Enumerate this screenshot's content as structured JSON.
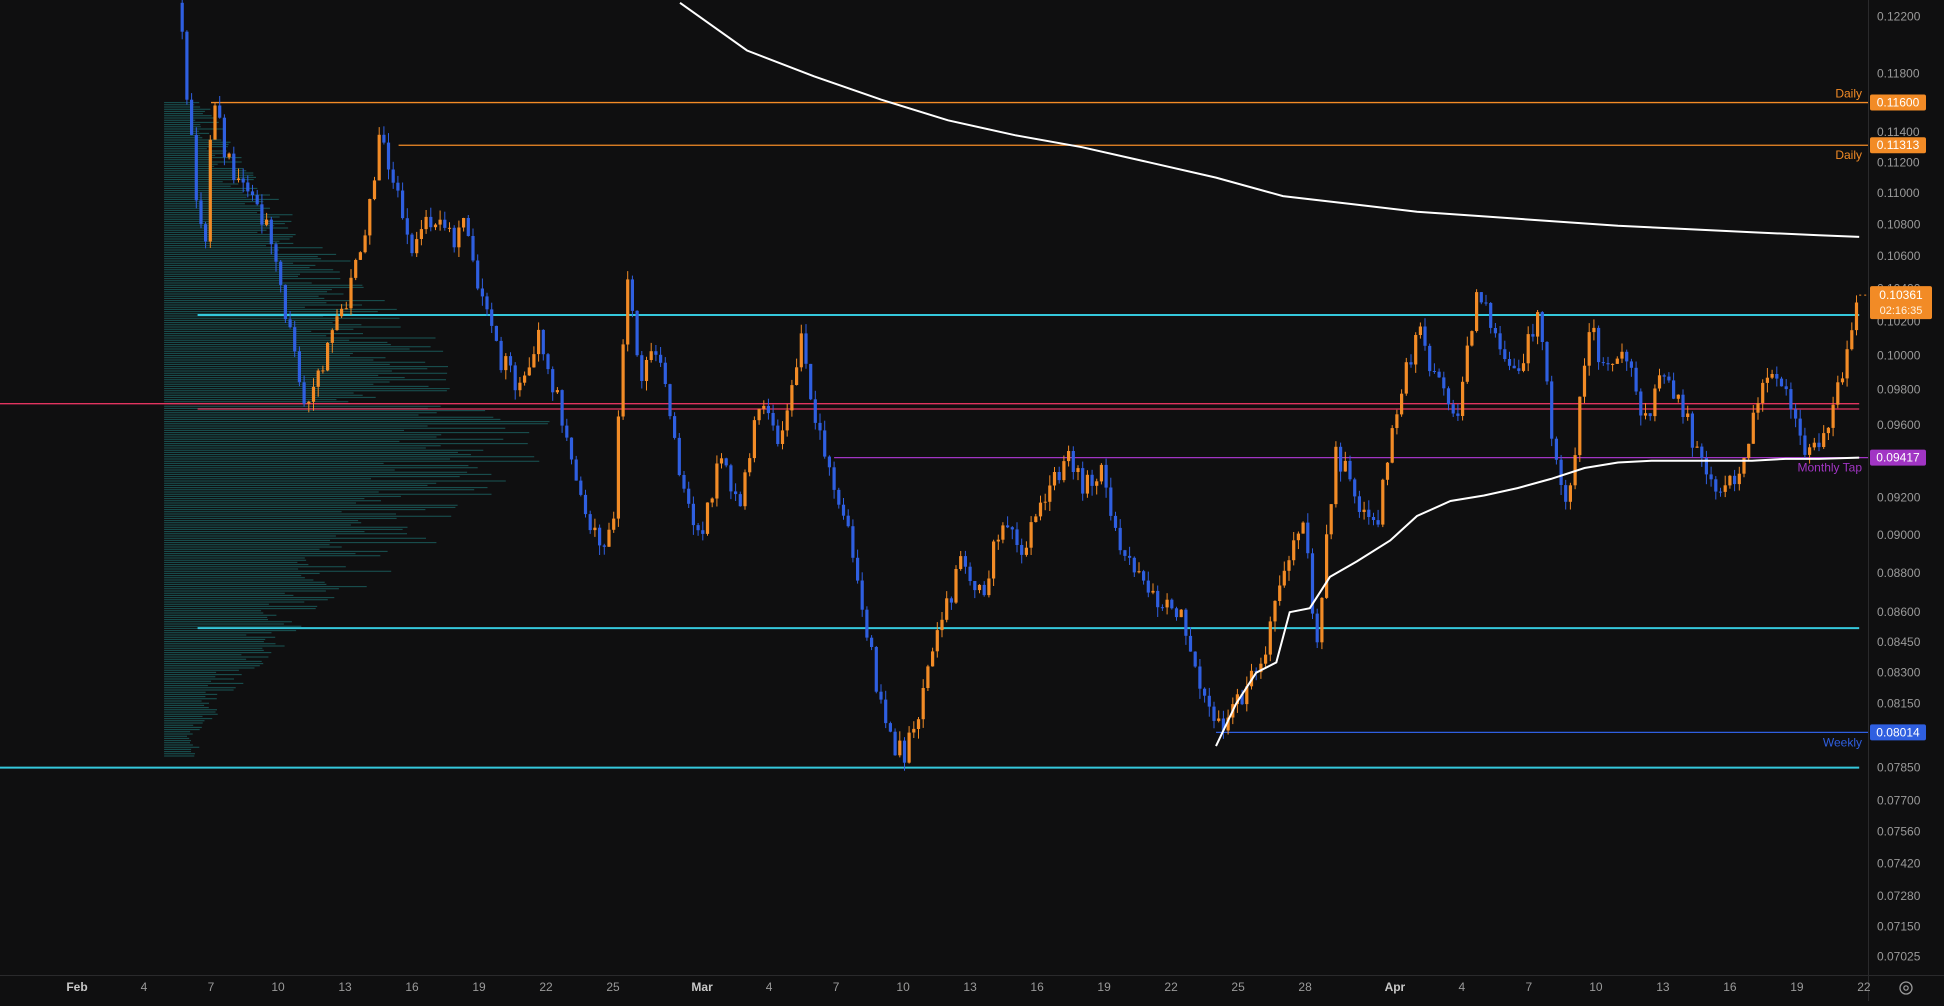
{
  "chart_data": {
    "type": "candlestick",
    "title": "",
    "xlabel": "",
    "ylabel": "",
    "x_range": [
      -2,
      29
    ],
    "y_scale": "log",
    "ylim": [
      0.0695,
      0.1232
    ],
    "grid": false,
    "colors": {
      "background": "#0f0f10",
      "up": "#f28b26",
      "down": "#2f5fe0",
      "cyan_level": "#35c8dc",
      "red_level": "#e2345f",
      "purple_level": "#a135c4",
      "daily_level": "#f28b26",
      "weekly_level": "#2f5fe0",
      "ma_line": "#ffffff",
      "volume_profile": "#1f7b7b",
      "axis_text": "#9a9a9a"
    },
    "y_ticks": [
      "0.12200",
      "0.11800",
      "0.11400",
      "0.11200",
      "0.11000",
      "0.10800",
      "0.10600",
      "0.10400",
      "0.10200",
      "0.10000",
      "0.09800",
      "0.09600",
      "0.09200",
      "0.09000",
      "0.08800",
      "0.08600",
      "0.08450",
      "0.08300",
      "0.08150",
      "0.07850",
      "0.07700",
      "0.07560",
      "0.07420",
      "0.07280",
      "0.07150",
      "0.07025"
    ],
    "x_ticks": [
      {
        "label": "Feb",
        "x": 0
      },
      {
        "label": "4",
        "x": 1
      },
      {
        "label": "7",
        "x": 2
      },
      {
        "label": "10",
        "x": 3
      },
      {
        "label": "13",
        "x": 4
      },
      {
        "label": "16",
        "x": 5
      },
      {
        "label": "19",
        "x": 6
      },
      {
        "label": "22",
        "x": 7
      },
      {
        "label": "25",
        "x": 8
      },
      {
        "label": "Mar",
        "x": 9.33
      },
      {
        "label": "4",
        "x": 10.33
      },
      {
        "label": "7",
        "x": 11.33
      },
      {
        "label": "10",
        "x": 12.33
      },
      {
        "label": "13",
        "x": 13.33
      },
      {
        "label": "16",
        "x": 14.33
      },
      {
        "label": "19",
        "x": 15.33
      },
      {
        "label": "22",
        "x": 16.33
      },
      {
        "label": "25",
        "x": 17.33
      },
      {
        "label": "28",
        "x": 18.33
      },
      {
        "label": "Apr",
        "x": 19.67
      },
      {
        "label": "4",
        "x": 20.67
      },
      {
        "label": "7",
        "x": 21.67
      },
      {
        "label": "10",
        "x": 22.67
      },
      {
        "label": "13",
        "x": 23.67
      },
      {
        "label": "16",
        "x": 24.67
      },
      {
        "label": "19",
        "x": 25.67
      },
      {
        "label": "22",
        "x": 26.67
      }
    ],
    "price_path": [
      [
        1.5,
        0.123
      ],
      [
        1.6,
        0.119
      ],
      [
        1.75,
        0.111
      ],
      [
        1.9,
        0.106
      ],
      [
        2.0,
        0.114
      ],
      [
        2.05,
        0.1165
      ],
      [
        2.2,
        0.1125
      ],
      [
        2.4,
        0.111
      ],
      [
        2.6,
        0.1095
      ],
      [
        2.8,
        0.108
      ],
      [
        3.0,
        0.105
      ],
      [
        3.2,
        0.101
      ],
      [
        3.4,
        0.0975
      ],
      [
        3.6,
        0.0985
      ],
      [
        3.8,
        0.1015
      ],
      [
        4.0,
        0.103
      ],
      [
        4.3,
        0.108
      ],
      [
        4.55,
        0.114
      ],
      [
        4.7,
        0.111
      ],
      [
        5.0,
        0.1065
      ],
      [
        5.3,
        0.1085
      ],
      [
        5.6,
        0.107
      ],
      [
        5.8,
        0.109
      ],
      [
        6.0,
        0.104
      ],
      [
        6.3,
        0.1
      ],
      [
        6.6,
        0.098
      ],
      [
        6.9,
        0.101
      ],
      [
        7.2,
        0.097
      ],
      [
        7.5,
        0.092
      ],
      [
        7.8,
        0.0895
      ],
      [
        8.0,
        0.0905
      ],
      [
        8.2,
        0.1045
      ],
      [
        8.4,
        0.099
      ],
      [
        8.7,
        0.1005
      ],
      [
        9.0,
        0.0935
      ],
      [
        9.3,
        0.0895
      ],
      [
        9.6,
        0.0945
      ],
      [
        9.9,
        0.0915
      ],
      [
        10.2,
        0.098
      ],
      [
        10.5,
        0.095
      ],
      [
        10.8,
        0.101
      ],
      [
        11.0,
        0.0965
      ],
      [
        11.3,
        0.092
      ],
      [
        11.6,
        0.089
      ],
      [
        11.9,
        0.083
      ],
      [
        12.1,
        0.08
      ],
      [
        12.35,
        0.079
      ],
      [
        12.6,
        0.0815
      ],
      [
        12.9,
        0.0855
      ],
      [
        13.2,
        0.0885
      ],
      [
        13.5,
        0.087
      ],
      [
        13.8,
        0.0905
      ],
      [
        14.1,
        0.089
      ],
      [
        14.4,
        0.092
      ],
      [
        14.8,
        0.094
      ],
      [
        15.0,
        0.0925
      ],
      [
        15.3,
        0.0935
      ],
      [
        15.6,
        0.089
      ],
      [
        15.9,
        0.0875
      ],
      [
        16.2,
        0.0865
      ],
      [
        16.5,
        0.086
      ],
      [
        16.8,
        0.082
      ],
      [
        17.1,
        0.08
      ],
      [
        17.4,
        0.082
      ],
      [
        17.7,
        0.0835
      ],
      [
        18.0,
        0.0885
      ],
      [
        18.3,
        0.091
      ],
      [
        18.5,
        0.0845
      ],
      [
        18.8,
        0.0945
      ],
      [
        19.1,
        0.092
      ],
      [
        19.4,
        0.0905
      ],
      [
        19.7,
        0.097
      ],
      [
        20.0,
        0.1015
      ],
      [
        20.3,
        0.0985
      ],
      [
        20.6,
        0.0965
      ],
      [
        20.9,
        0.104
      ],
      [
        21.2,
        0.101
      ],
      [
        21.5,
        0.0985
      ],
      [
        21.8,
        0.1025
      ],
      [
        22.1,
        0.093
      ],
      [
        22.3,
        0.092
      ],
      [
        22.55,
        0.102
      ],
      [
        22.8,
        0.099
      ],
      [
        23.1,
        0.1
      ],
      [
        23.4,
        0.096
      ],
      [
        23.7,
        0.099
      ],
      [
        24.0,
        0.0965
      ],
      [
        24.3,
        0.093
      ],
      [
        24.6,
        0.0925
      ],
      [
        24.9,
        0.094
      ],
      [
        25.2,
        0.0995
      ],
      [
        25.5,
        0.0975
      ],
      [
        25.8,
        0.094
      ],
      [
        26.1,
        0.096
      ],
      [
        26.4,
        0.0995
      ],
      [
        26.6,
        0.1036
      ]
    ],
    "ma_line": [
      [
        9.0,
        0.123
      ],
      [
        10.0,
        0.1196
      ],
      [
        11.0,
        0.1178
      ],
      [
        12.0,
        0.1162
      ],
      [
        13.0,
        0.1148
      ],
      [
        14.0,
        0.1138
      ],
      [
        15.0,
        0.113
      ],
      [
        16.0,
        0.112
      ],
      [
        17.0,
        0.111
      ],
      [
        18.0,
        0.1098
      ],
      [
        19.0,
        0.1093
      ],
      [
        20.0,
        0.1088
      ],
      [
        21.0,
        0.1085
      ],
      [
        22.0,
        0.1082
      ],
      [
        23.0,
        0.1079
      ],
      [
        24.0,
        0.1077
      ],
      [
        25.0,
        0.1075
      ],
      [
        26.0,
        0.1073
      ],
      [
        26.6,
        0.1072
      ]
    ],
    "vwap_line": [
      [
        17.0,
        0.0795
      ],
      [
        17.3,
        0.0815
      ],
      [
        17.6,
        0.083
      ],
      [
        17.9,
        0.0835
      ],
      [
        18.1,
        0.086
      ],
      [
        18.4,
        0.0862
      ],
      [
        18.7,
        0.0878
      ],
      [
        19.1,
        0.0886
      ],
      [
        19.6,
        0.0897
      ],
      [
        20.0,
        0.091
      ],
      [
        20.5,
        0.0918
      ],
      [
        21.0,
        0.0921
      ],
      [
        21.5,
        0.0925
      ],
      [
        22.0,
        0.093
      ],
      [
        22.5,
        0.0936
      ],
      [
        23.0,
        0.0939
      ],
      [
        23.5,
        0.094
      ],
      [
        24.0,
        0.094
      ],
      [
        24.5,
        0.094
      ],
      [
        25.0,
        0.094
      ],
      [
        25.5,
        0.0941
      ],
      [
        26.0,
        0.0941
      ],
      [
        26.6,
        0.09417
      ]
    ],
    "volume_profile": {
      "price_range": [
        0.079,
        0.116
      ],
      "peak_price": 0.097,
      "max_width_days": 6.0
    },
    "levels": [
      {
        "id": "daily-1",
        "price": 0.116,
        "label": "Daily",
        "badge": "0.11600",
        "color": "#f28b26",
        "x_start": 2.0,
        "x_end": 28.0,
        "label_pos": "above"
      },
      {
        "id": "daily-2",
        "price": 0.11313,
        "label": "Daily",
        "badge": "0.11313",
        "color": "#f28b26",
        "x_start": 4.8,
        "x_end": 28.0,
        "label_pos": "below"
      },
      {
        "id": "cyan-upper",
        "price": 0.1024,
        "label": "",
        "badge": "",
        "color": "#35c8dc",
        "x_start": 1.8,
        "x_end": 26.6,
        "label_pos": ""
      },
      {
        "id": "red-1",
        "price": 0.0972,
        "label": "",
        "badge": "",
        "color": "#e2345f",
        "x_start": -2,
        "x_end": 26.6,
        "label_pos": ""
      },
      {
        "id": "red-2",
        "price": 0.0969,
        "label": "",
        "badge": "",
        "color": "#e2345f",
        "x_start": 1.8,
        "x_end": 26.6,
        "label_pos": ""
      },
      {
        "id": "monthly-tap",
        "price": 0.09417,
        "label": "Monthly Tap",
        "badge": "0.09417",
        "color": "#a135c4",
        "x_start": 11.3,
        "x_end": 28.0,
        "label_pos": "below"
      },
      {
        "id": "cyan-mid",
        "price": 0.0852,
        "label": "",
        "badge": "",
        "color": "#35c8dc",
        "x_start": 1.8,
        "x_end": 26.6,
        "label_pos": ""
      },
      {
        "id": "weekly",
        "price": 0.08014,
        "label": "Weekly",
        "badge": "0.08014",
        "color": "#2f5fe0",
        "x_start": 17.0,
        "x_end": 28.0,
        "label_pos": "below"
      },
      {
        "id": "cyan-lower",
        "price": 0.0785,
        "label": "",
        "badge": "",
        "color": "#35c8dc",
        "x_start": -2,
        "x_end": 26.6,
        "label_pos": ""
      }
    ],
    "current_price": {
      "value": "0.10361",
      "countdown": "02:16:35",
      "price": 0.1036,
      "color": "#f28b26"
    }
  }
}
